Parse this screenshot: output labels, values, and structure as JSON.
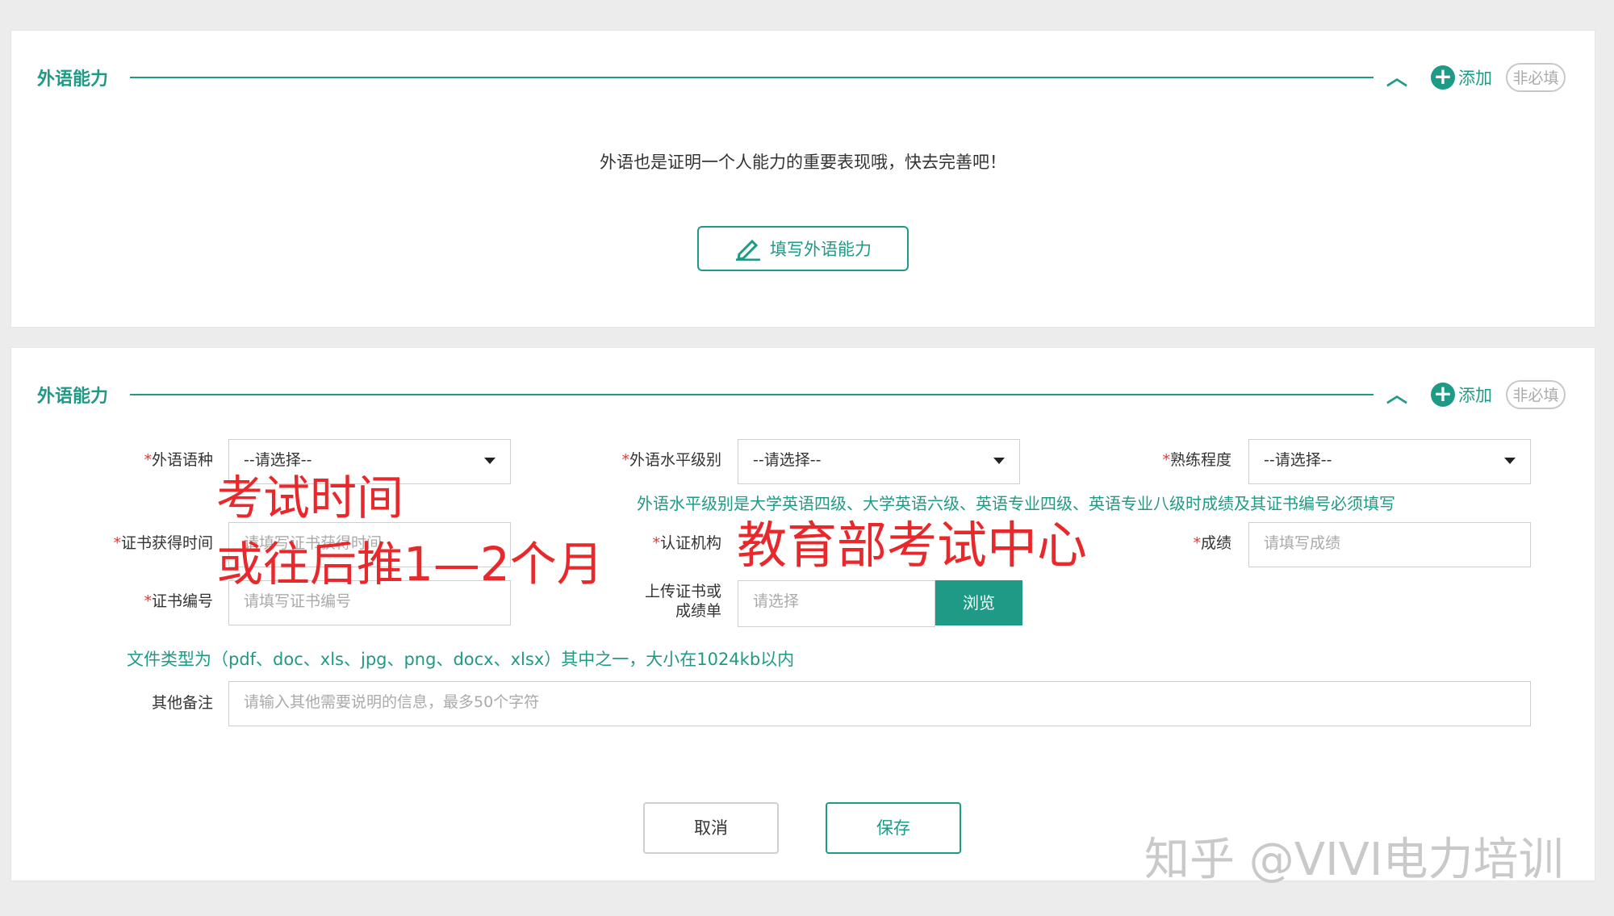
{
  "section1": {
    "title": "外语能力",
    "add_label": "添加",
    "optional_badge": "非必填",
    "empty_message": "外语也是证明一个人能力的重要表现哦，快去完善吧！",
    "fill_button": "填写外语能力"
  },
  "section2": {
    "title": "外语能力",
    "add_label": "添加",
    "optional_badge": "非必填",
    "form": {
      "language": {
        "required_mark": "*",
        "label": "外语语种",
        "value": "--请选择--"
      },
      "level": {
        "required_mark": "*",
        "label": "外语水平级别",
        "value": "--请选择--"
      },
      "proficiency": {
        "required_mark": "*",
        "label": "熟练程度",
        "value": "--请选择--"
      },
      "level_hint": "外语水平级别是大学英语四级、大学英语六级、英语专业四级、英语专业八级时成绩及其证书编号必须填写",
      "cert_time": {
        "required_mark": "*",
        "label": "证书获得时间",
        "placeholder": "请填写证书获得时间"
      },
      "cert_org": {
        "required_mark": "*",
        "label": "认证机构",
        "placeholder": ""
      },
      "score": {
        "required_mark": "*",
        "label": "成绩",
        "placeholder": "请填写成绩"
      },
      "cert_no": {
        "required_mark": "*",
        "label": "证书编号",
        "placeholder": "请填写证书编号"
      },
      "upload": {
        "label_line1": "上传证书或",
        "label_line2": "成绩单",
        "placeholder": "请选择",
        "browse": "浏览"
      },
      "file_hint": "文件类型为（pdf、doc、xls、jpg、png、docx、xlsx）其中之一，大小在1024kb以内",
      "remarks": {
        "label": "其他备注",
        "placeholder": "请输入其他需要说明的信息，最多50个字符"
      }
    },
    "cancel": "取消",
    "save": "保存"
  },
  "annotations": {
    "exam_time_line1": "考试时间",
    "exam_time_line2": "或往后推1—2个月",
    "org_note": "教育部考试中心"
  },
  "watermark": "知乎 @VIVI电力培训",
  "colors": {
    "accent": "#1f9a86",
    "required": "#e33333",
    "annotation": "#e8282b"
  },
  "icons": [
    "chevron-up-icon",
    "plus-circle-icon",
    "pencil-icon",
    "dropdown-caret-icon"
  ]
}
